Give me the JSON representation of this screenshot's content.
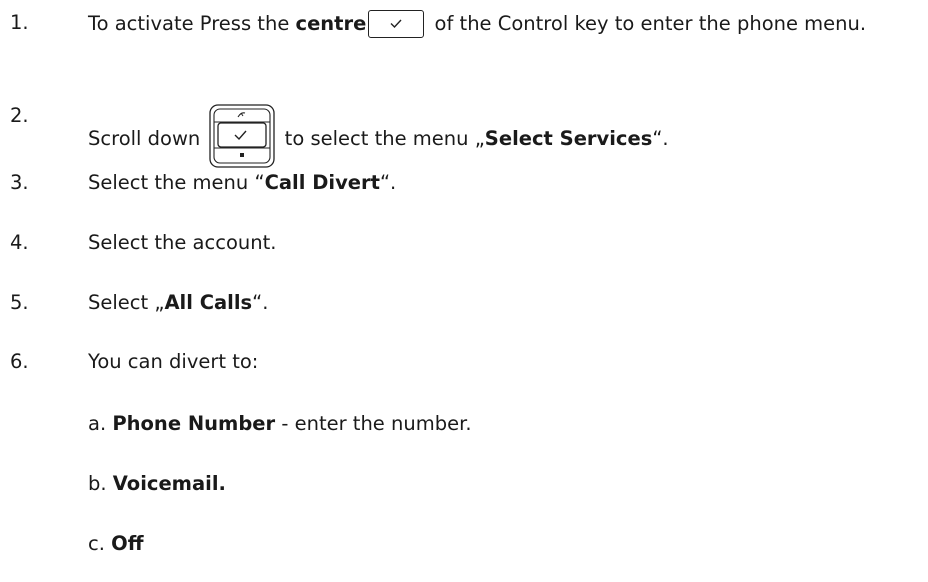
{
  "steps": [
    {
      "num": "1.",
      "before": "To activate Press the ",
      "bold": "centre",
      "after": " of the Control key to enter the phone menu.",
      "icon": "control-key-centre-icon"
    },
    {
      "num": "2.",
      "before": "Scroll down ",
      "middle": " to select the menu „",
      "bold": "Select Services",
      "after": "“.",
      "icon": "navigation-key-icon"
    },
    {
      "num": "3.",
      "before": "Select the menu “",
      "bold": "Call Divert",
      "after": "“."
    },
    {
      "num": "4.",
      "text": "Select the account."
    },
    {
      "num": "5.",
      "before": "Select „",
      "bold": "All Calls",
      "after": "“."
    },
    {
      "num": "6.",
      "text": "You can divert to:"
    }
  ],
  "options": [
    {
      "prefix": "a. ",
      "bold": "Phone Number",
      "after": " - enter the number."
    },
    {
      "prefix": "b. ",
      "bold": "Voicemail.",
      "after": ""
    },
    {
      "prefix": "c. ",
      "bold": "Off",
      "after": ""
    }
  ]
}
